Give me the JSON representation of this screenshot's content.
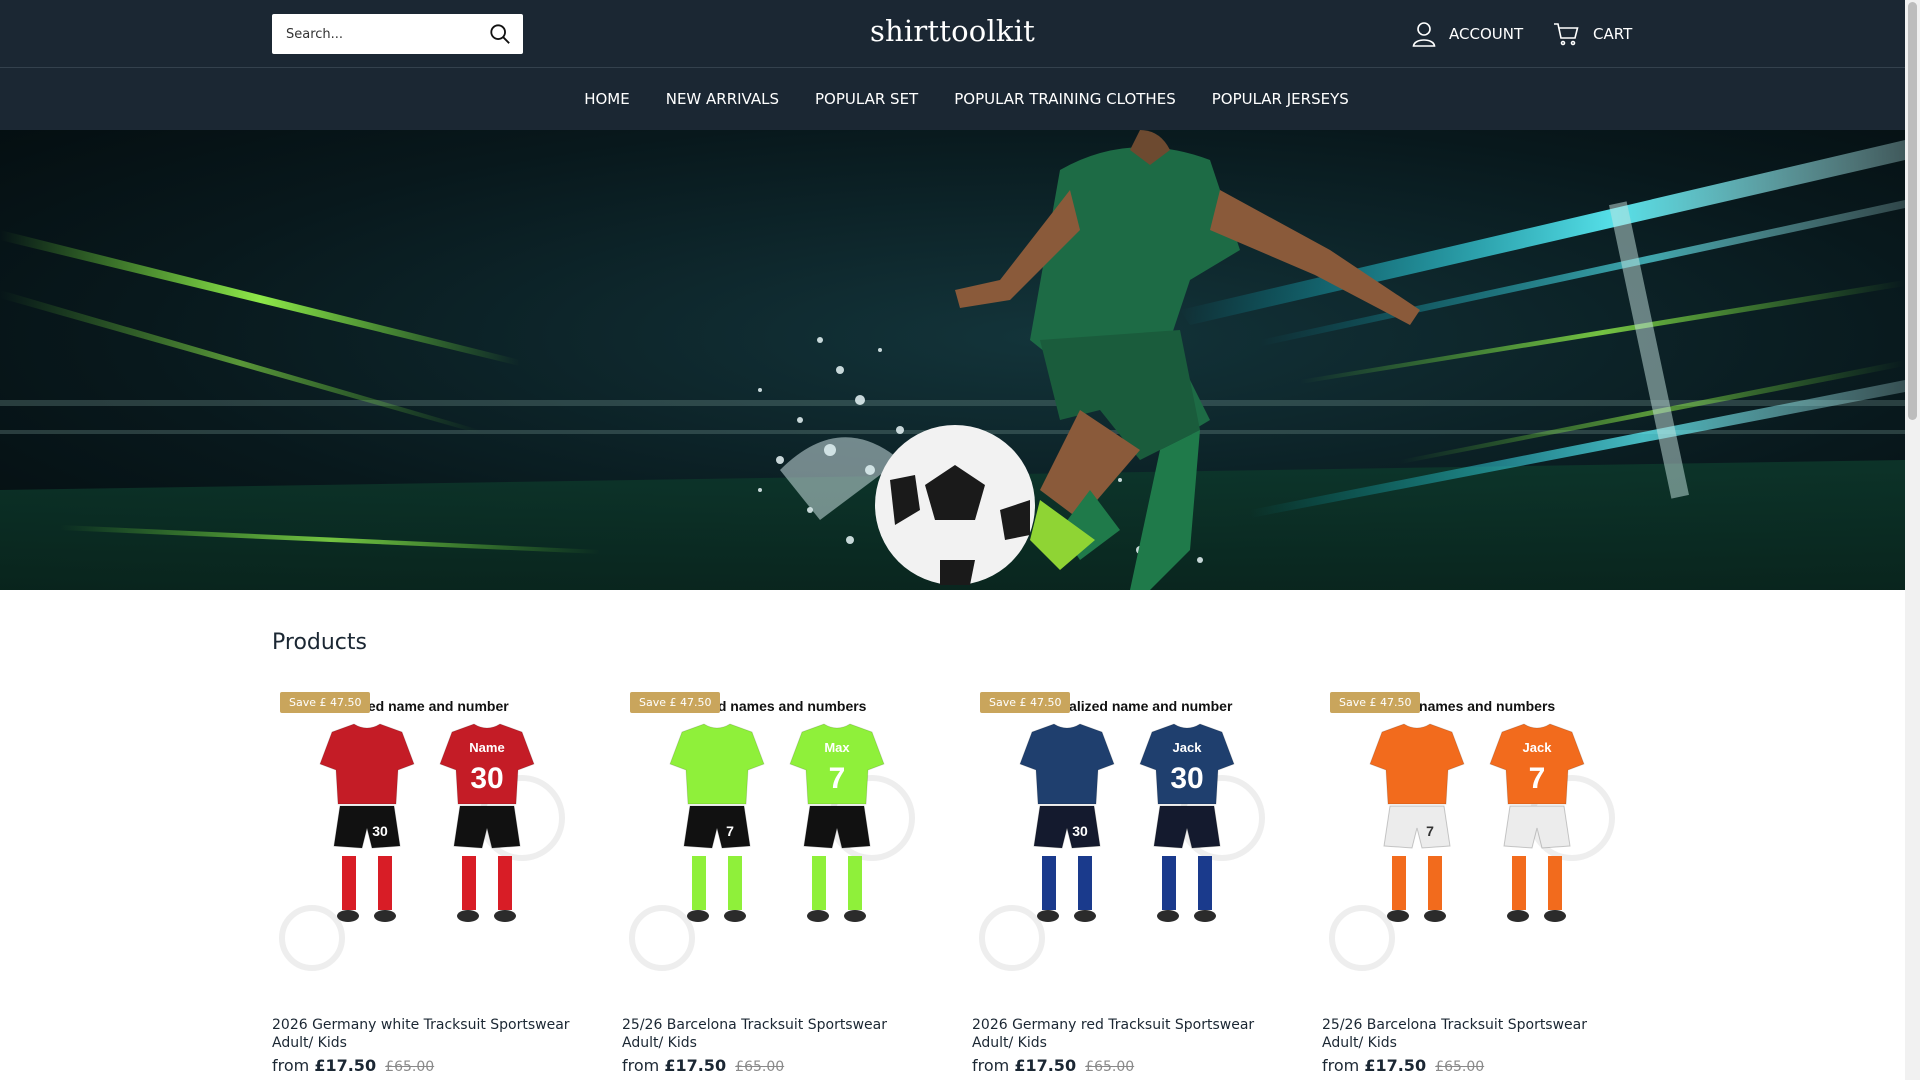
{
  "header": {
    "search_placeholder": "Search...",
    "logo": "shirttoolkit",
    "account_label": "ACCOUNT",
    "cart_label": "CART"
  },
  "nav": {
    "items": [
      "HOME",
      "NEW ARRIVALS",
      "POPULAR SET",
      "POPULAR TRAINING CLOTHES",
      "POPULAR JERSEYS"
    ]
  },
  "products": {
    "heading": "Products",
    "items": [
      {
        "badge": "Save £ 47.50",
        "caption": "alized name and number",
        "title": "2026 Germany white Tracksuit Sportswear Adult/ Kids",
        "from": "from",
        "price": "£17.50",
        "old_price": "£65.00",
        "colors": {
          "shirt": "#c41c26",
          "shorts": "#111111",
          "socks": "#d81d26"
        },
        "name_print": "Name",
        "number_print": "30"
      },
      {
        "badge": "Save £ 47.50",
        "caption": "alized names and numbers",
        "title": "25/26 Barcelona Tracksuit Sportswear Adult/ Kids",
        "from": "from",
        "price": "£17.50",
        "old_price": "£65.00",
        "colors": {
          "shirt": "#8ff03a",
          "shorts": "#111111",
          "socks": "#8ff03a"
        },
        "name_print": "Max",
        "number_print": "7"
      },
      {
        "badge": "Save £ 47.50",
        "caption": "Personalized name and number",
        "title": "2026 Germany red Tracksuit Sportswear Adult/ Kids",
        "from": "from",
        "price": "£17.50",
        "old_price": "£65.00",
        "colors": {
          "shirt": "#1f3f6e",
          "shorts": "#141a2e",
          "socks": "#1a3a8c"
        },
        "name_print": "Jack",
        "number_print": "30"
      },
      {
        "badge": "Save £ 47.50",
        "caption": "ed names and numbers",
        "title": "25/26 Barcelona Tracksuit Sportswear Adult/ Kids",
        "from": "from",
        "price": "£17.50",
        "old_price": "£65.00",
        "colors": {
          "shirt": "#f26b1d",
          "shorts": "#ececec",
          "socks": "#f26b1d"
        },
        "name_print": "Jack",
        "number_print": "7"
      }
    ]
  }
}
